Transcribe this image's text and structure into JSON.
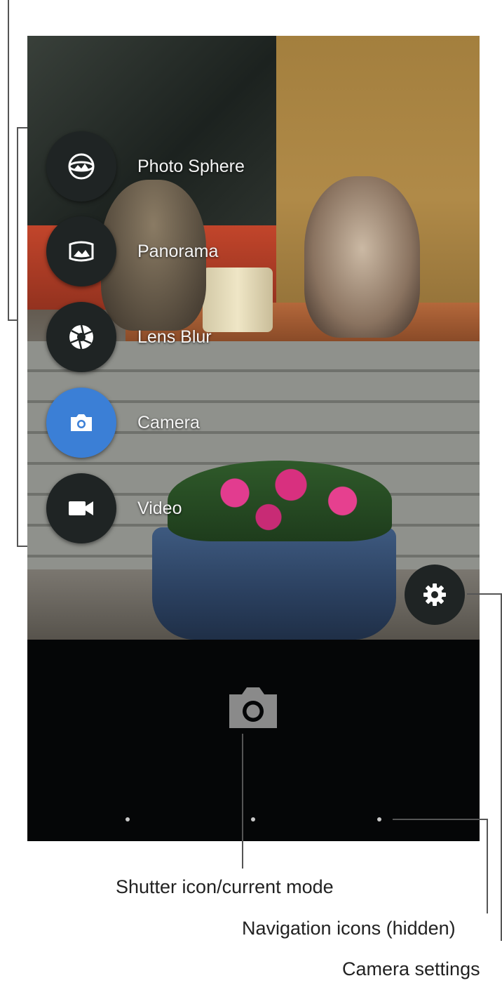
{
  "modes": [
    {
      "label": "Photo Sphere",
      "icon": "photo-sphere-icon",
      "active": false
    },
    {
      "label": "Panorama",
      "icon": "panorama-icon",
      "active": false
    },
    {
      "label": "Lens Blur",
      "icon": "lens-blur-icon",
      "active": false
    },
    {
      "label": "Camera",
      "icon": "camera-icon",
      "active": true
    },
    {
      "label": "Video",
      "icon": "video-icon",
      "active": false
    }
  ],
  "controls": {
    "settings_icon": "gear-icon",
    "shutter_icon": "camera-shutter-icon",
    "nav_dot_count": 3
  },
  "captions": {
    "shutter": "Shutter icon/current mode",
    "navigation": "Navigation icons (hidden)",
    "settings": "Camera settings"
  },
  "colors": {
    "active_mode": "#3b7fd6",
    "mode_button": "#1f2424",
    "controls_bg": "#050607"
  }
}
